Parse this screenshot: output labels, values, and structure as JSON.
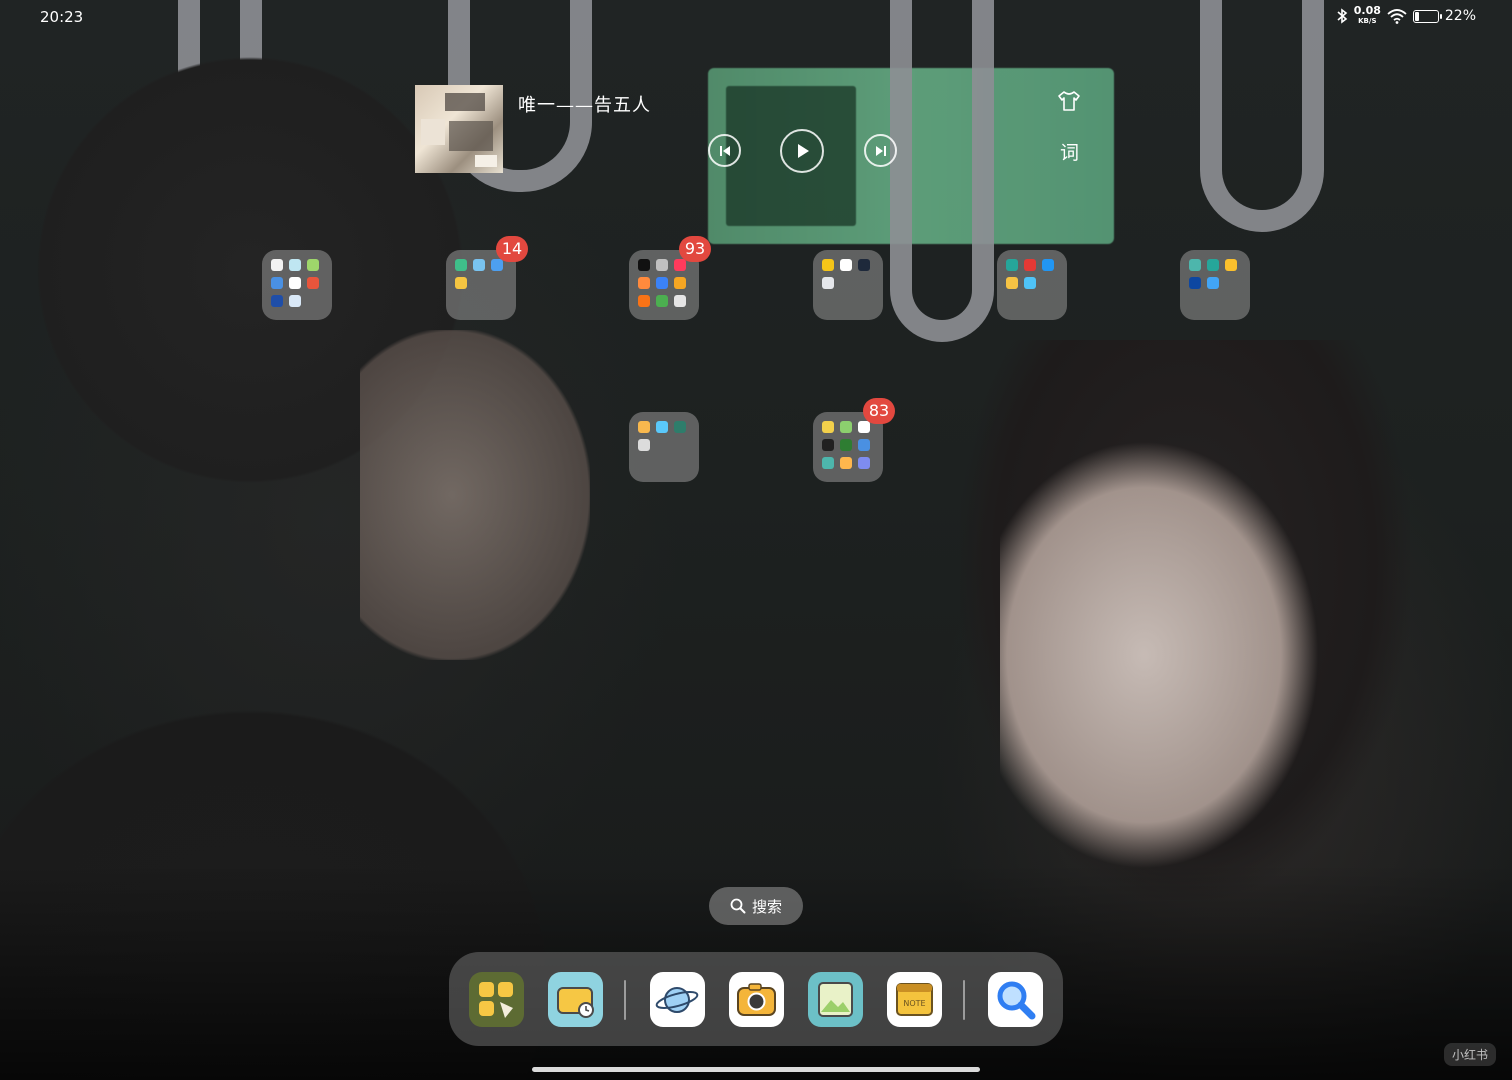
{
  "status_bar": {
    "time": "20:23",
    "net_speed": "0.08",
    "net_speed_unit": "KB/S",
    "battery_text": "22%",
    "battery_level": 0.22,
    "icons": [
      "bluetooth-icon",
      "wifi-icon",
      "battery-icon"
    ]
  },
  "music_widget": {
    "title": "唯一——告五人",
    "lyrics_label": "词",
    "controls": [
      "previous-track-icon",
      "play-icon",
      "next-track-icon"
    ]
  },
  "folders": [
    {
      "badge": "",
      "apps": [
        "#f2f2f2",
        "#bfe6f2",
        "#9ed66b",
        "#4a90e2",
        "#ffffff",
        "#e8553c",
        "#1f4ea8",
        "#d9e8f7"
      ]
    },
    {
      "badge": "14",
      "apps": [
        "#3fbf8a",
        "#79c3f0",
        "#4d9ff0",
        "#f5c542"
      ]
    },
    {
      "badge": "93",
      "apps": [
        "#111111",
        "#c0c0c0",
        "#ff3b5c",
        "#ff8a3d",
        "#3b82f6",
        "#f6a623",
        "#f97316",
        "#4caf50",
        "#e5e5e5"
      ]
    },
    {
      "badge": "",
      "apps": [
        "#f5c518",
        "#ffffff",
        "#1e293b",
        "#e5e7eb"
      ]
    },
    {
      "badge": "",
      "apps": [
        "#26a69a",
        "#e53935",
        "#2196f3",
        "#f6c344",
        "#4fc3f7"
      ]
    },
    {
      "badge": "",
      "apps": [
        "#4db6ac",
        "#26a69a",
        "#fbc02d",
        "#0d47a1",
        "#42a5f5"
      ]
    },
    {
      "badge": "",
      "apps": [
        "#f8b84e",
        "#5ac8fa",
        "#2e7d6b",
        "#dcdcdc"
      ]
    },
    {
      "badge": "83",
      "apps": [
        "#f2d04b",
        "#8ccf6e",
        "#ffffff",
        "#212121",
        "#2e7d32",
        "#4a90e2",
        "#4db6ac",
        "#ffb74d",
        "#7e8cf0"
      ]
    }
  ],
  "search": {
    "label": "搜索",
    "icon": "search-icon"
  },
  "dock": {
    "apps": [
      {
        "name": "app-store",
        "colors": [
          "#6b7a3a",
          "#f6c744"
        ]
      },
      {
        "name": "wallet",
        "colors": [
          "#8fd3e0",
          "#f6c744"
        ]
      },
      {
        "name": "browser",
        "colors": [
          "#ffffff",
          "#4a8fe0"
        ]
      },
      {
        "name": "camera",
        "colors": [
          "#ffffff",
          "#f4b53a"
        ]
      },
      {
        "name": "gallery",
        "colors": [
          "#6cc0c7",
          "#e6f3c7"
        ]
      },
      {
        "name": "notes",
        "label": "NOTE",
        "colors": [
          "#ffffff",
          "#f4c33d"
        ]
      },
      {
        "name": "search",
        "colors": [
          "#ffffff",
          "#2f7ef2"
        ]
      }
    ]
  },
  "watermark": "小红书"
}
